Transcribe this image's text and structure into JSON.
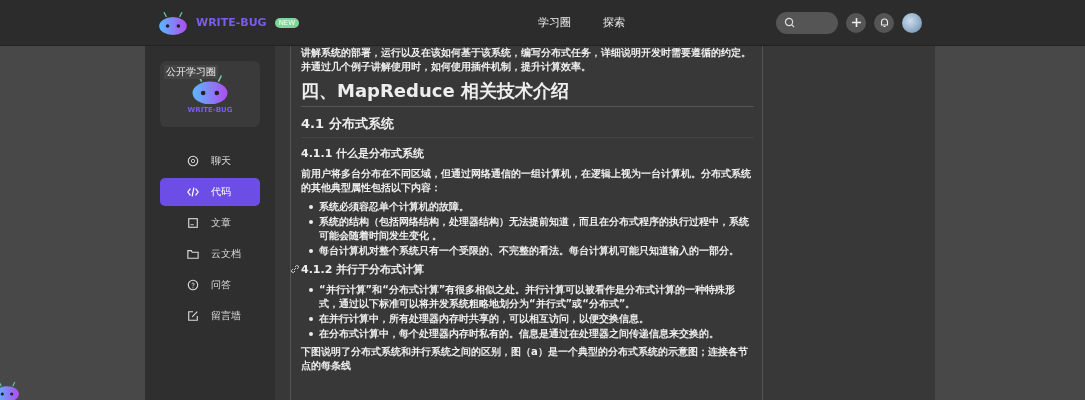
{
  "header": {
    "brand": "WRITE-BUG",
    "badge": "NEW",
    "nav": [
      {
        "label": "学习圈",
        "selected": false
      },
      {
        "label": "探索",
        "selected": false
      }
    ]
  },
  "sidebar": {
    "card": {
      "tag": "公开学习圈",
      "name": "WRITE-BUG"
    },
    "items": [
      {
        "label": "聊天",
        "selected": false
      },
      {
        "label": "代码",
        "selected": true
      },
      {
        "label": "文章",
        "selected": false
      },
      {
        "label": "云文档",
        "selected": false
      },
      {
        "label": "问答",
        "selected": false
      },
      {
        "label": "留言墙",
        "selected": false
      }
    ]
  },
  "article": [
    {
      "kind": "p",
      "text": "讲解系统的部署，运行以及在该如何基于该系统，编写分布式任务，详细说明开发时需要遵循的约定。并通过几个例子讲解使用时，如何使用插件机制，提升计算效率。"
    },
    {
      "kind": "h1",
      "text": "四、MapReduce 相关技术介绍"
    },
    {
      "kind": "h2",
      "text": "4.1 分布式系统"
    },
    {
      "kind": "h3",
      "text": "4.1.1 什么是分布式系统"
    },
    {
      "kind": "p",
      "text": "前用户将多台分布在不同区域，但通过网络通信的一组计算机，在逻辑上视为一台计算机。分布式系统的其他典型属性包括以下内容："
    },
    {
      "kind": "ul",
      "items": [
        "系统必须容忍单个计算机的故障。",
        "系统的结构（包括网络结构，处理器结构）无法提前知道，而且在分布式程序的执行过程中，系统可能会随着时间发生变化 。",
        "每台计算机对整个系统只有一个受限的、不完整的看法。每台计算机可能只知道输入的一部分。"
      ]
    },
    {
      "kind": "h3",
      "text": "4.1.2 并行于分布式计算",
      "anchor": true
    },
    {
      "kind": "ul",
      "items": [
        "“并行计算”和“分布式计算”有很多相似之处。并行计算可以被看作是分布式计算的一种特殊形式，通过以下标准可以将并发系统粗略地划分为“并行式”或“分布式”。",
        "在并行计算中，所有处理器内存时共享的，可以相互访问，以便交换信息。",
        "在分布式计算中，每个处理器内存时私有的。信息是通过在处理器之间传递信息来交换的。"
      ]
    },
    {
      "kind": "p",
      "text": "下图说明了分布式系统和并行系统之间的区别，图（a）是一个典型的分布式系统的示意图；连接各节点的每条线"
    }
  ]
}
